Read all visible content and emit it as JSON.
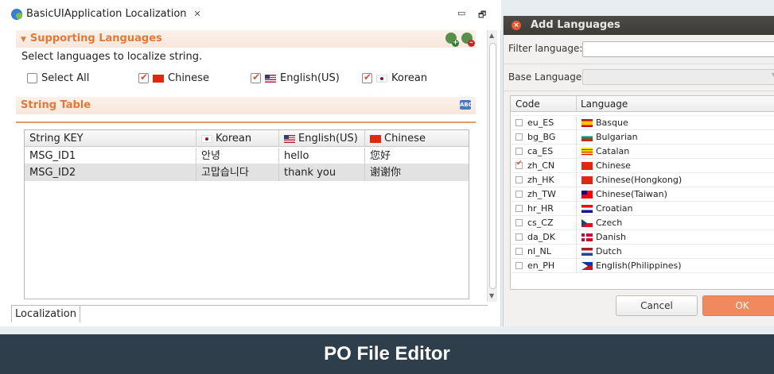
{
  "editor": {
    "tab_title": "BasicUIApplication Localization",
    "tab_close_glyph": "✕",
    "minimize_glyph": "▭",
    "maximize_glyph": "🗗",
    "supporting_title": "Supporting Languages",
    "hint": "Select languages to localize string.",
    "select_all_label": "Select All",
    "languages": [
      {
        "label": "Chinese",
        "flag": "cn",
        "checked": true
      },
      {
        "label": "English(US)",
        "flag": "us",
        "checked": true
      },
      {
        "label": "Korean",
        "flag": "kr",
        "checked": true
      }
    ],
    "string_table_title": "String Table",
    "columns": [
      "String KEY",
      "Korean",
      "English(US)",
      "Chinese"
    ],
    "rows": [
      {
        "key": "MSG_ID1",
        "korean": "안녕",
        "english": "hello",
        "chinese": "您好"
      },
      {
        "key": "MSG_ID2",
        "korean": "고맙습니다",
        "english": "thank you",
        "chinese": "谢谢你"
      }
    ],
    "bottom_tab": "Localization"
  },
  "dialog": {
    "title": "Add Languages",
    "filter_label": "Filter language:",
    "filter_value": "",
    "base_label": "Base Language:",
    "base_value": "",
    "col_code": "Code",
    "col_language": "Language",
    "items": [
      {
        "code": "eu_ES",
        "language": "Basque",
        "flag": "es",
        "checked": false
      },
      {
        "code": "bg_BG",
        "language": "Bulgarian",
        "flag": "bg",
        "checked": false
      },
      {
        "code": "ca_ES",
        "language": "Catalan",
        "flag": "ca",
        "checked": false
      },
      {
        "code": "zh_CN",
        "language": "Chinese",
        "flag": "cn",
        "checked": true
      },
      {
        "code": "zh_HK",
        "language": "Chinese(Hongkong)",
        "flag": "hk",
        "checked": false
      },
      {
        "code": "zh_TW",
        "language": "Chinese(Taiwan)",
        "flag": "tw",
        "checked": false
      },
      {
        "code": "hr_HR",
        "language": "Croatian",
        "flag": "hr",
        "checked": false
      },
      {
        "code": "cs_CZ",
        "language": "Czech",
        "flag": "cz",
        "checked": false
      },
      {
        "code": "da_DK",
        "language": "Danish",
        "flag": "dk",
        "checked": false
      },
      {
        "code": "nl_NL",
        "language": "Dutch",
        "flag": "nl",
        "checked": false
      },
      {
        "code": "en_PH",
        "language": "English(Philippines)",
        "flag": "ph",
        "checked": false
      }
    ],
    "cancel_label": "Cancel",
    "ok_label": "OK"
  },
  "banner": {
    "title": "PO File Editor"
  },
  "colors": {
    "accent": "#e07a3a",
    "ok_button": "#f08a5e",
    "banner_bg": "#2e3e4a"
  }
}
